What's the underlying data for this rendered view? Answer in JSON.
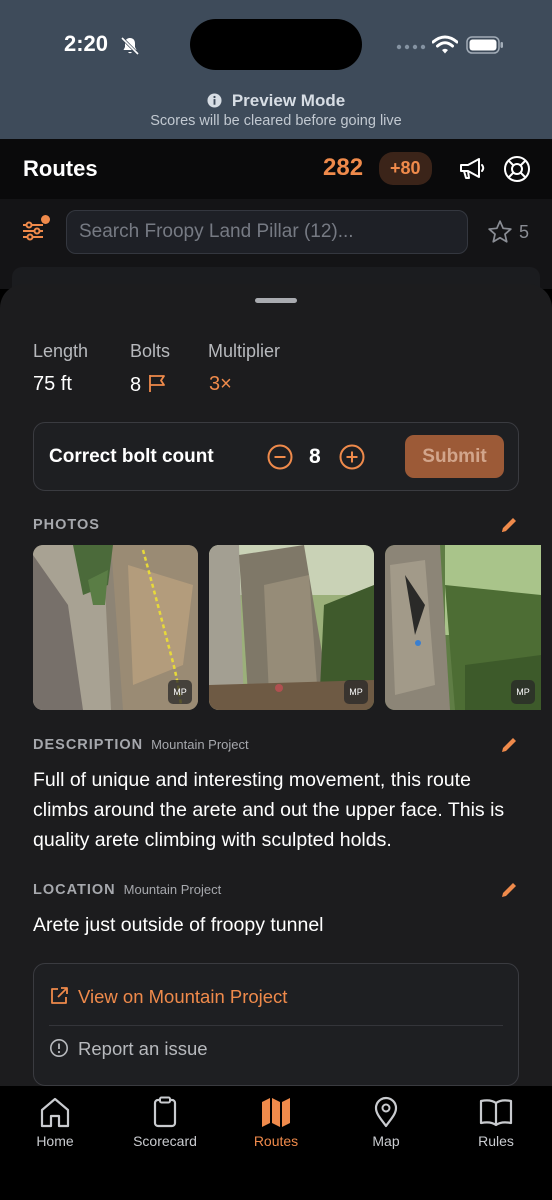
{
  "status": {
    "time": "2:20"
  },
  "preview": {
    "title": "Preview Mode",
    "subtitle": "Scores will be cleared before going live"
  },
  "header": {
    "title": "Routes",
    "score": "282",
    "bonus": "+80"
  },
  "search": {
    "placeholder": "Search Froopy Land Pillar (12)...",
    "star_count": "5"
  },
  "stats": [
    {
      "label": "Length",
      "value": "75 ft"
    },
    {
      "label": "Bolts",
      "value": "8"
    },
    {
      "label": "Multiplier",
      "value": "3×"
    }
  ],
  "bolt_count": {
    "label": "Correct bolt count",
    "value": "8",
    "submit_label": "Submit"
  },
  "photos": {
    "title": "PHOTOS",
    "badge": "MP"
  },
  "description": {
    "title": "DESCRIPTION",
    "source": "Mountain Project",
    "text": "Full of unique and interesting movement, this route climbs around the arete and out the upper face. This is quality arete climbing with sculpted holds."
  },
  "location": {
    "title": "LOCATION",
    "source": "Mountain Project",
    "text": "Arete just outside of froopy tunnel"
  },
  "links": {
    "mountain_project": "View on Mountain Project",
    "report": "Report an issue"
  },
  "tabs": [
    {
      "label": "Home",
      "icon": "home-icon"
    },
    {
      "label": "Scorecard",
      "icon": "clipboard-icon"
    },
    {
      "label": "Routes",
      "icon": "map-icon"
    },
    {
      "label": "Map",
      "icon": "map-pin-icon"
    },
    {
      "label": "Rules",
      "icon": "book-icon"
    }
  ],
  "colors": {
    "accent": "#ef8a4b",
    "preview_bg": "#3e4b5a",
    "sheet_bg": "#1c1c1e"
  }
}
